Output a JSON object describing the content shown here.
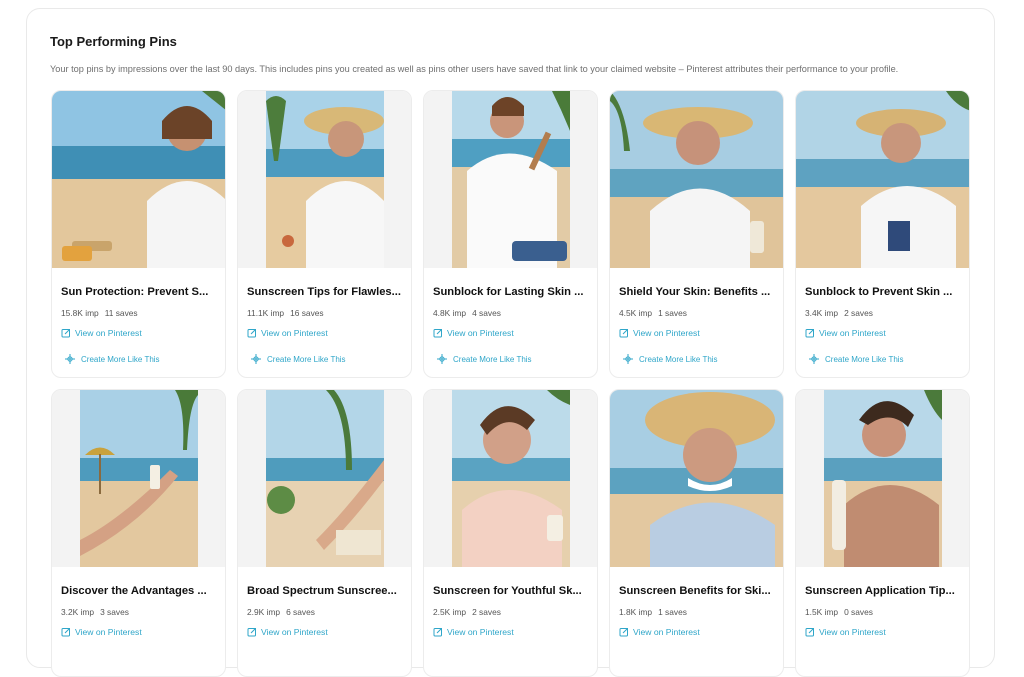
{
  "section": {
    "title": "Top Performing Pins",
    "description": "Your top pins by impressions over the last 90 days. This includes pins you created as well as pins other users have saved that link to your claimed website – Pinterest attributes their performance to your profile."
  },
  "actions": {
    "view": "View on Pinterest",
    "create_more": "Create More Like This"
  },
  "colors": {
    "accent": "#2fa6c9",
    "border": "#ececec"
  },
  "pins": [
    {
      "title": "Sun Protection: Prevent S...",
      "impressions": "15.8K imp",
      "saves": "11 saves"
    },
    {
      "title": "Sunscreen Tips for Flawles...",
      "impressions": "11.1K imp",
      "saves": "16 saves"
    },
    {
      "title": "Sunblock for Lasting Skin ...",
      "impressions": "4.8K imp",
      "saves": "4 saves"
    },
    {
      "title": "Shield Your Skin: Benefits ...",
      "impressions": "4.5K imp",
      "saves": "1 saves"
    },
    {
      "title": "Sunblock to Prevent Skin ...",
      "impressions": "3.4K imp",
      "saves": "2 saves"
    },
    {
      "title": "Discover the Advantages ...",
      "impressions": "3.2K imp",
      "saves": "3 saves"
    },
    {
      "title": "Broad Spectrum Sunscree...",
      "impressions": "2.9K imp",
      "saves": "6 saves"
    },
    {
      "title": "Sunscreen for Youthful Sk...",
      "impressions": "2.5K imp",
      "saves": "2 saves"
    },
    {
      "title": "Sunscreen Benefits for Ski...",
      "impressions": "1.8K imp",
      "saves": "1 saves"
    },
    {
      "title": "Sunscreen Application Tip...",
      "impressions": "1.5K imp",
      "saves": "0 saves"
    }
  ]
}
